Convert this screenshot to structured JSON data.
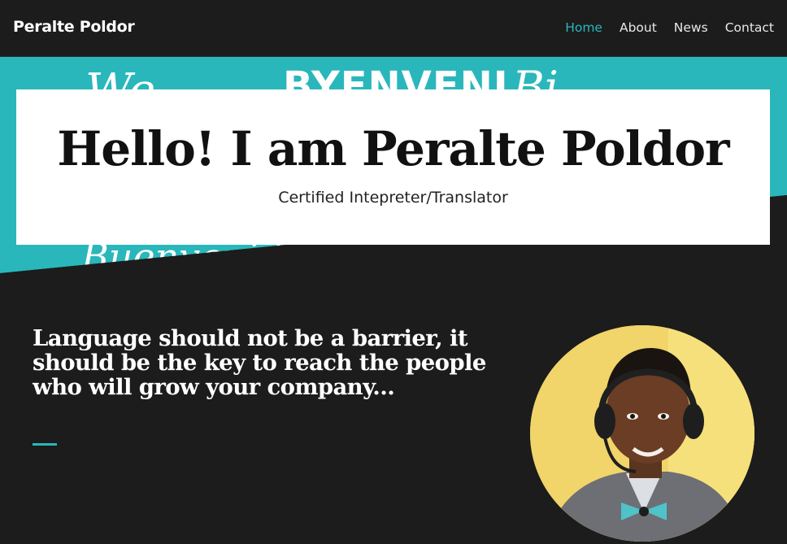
{
  "nav": {
    "brand": "Peralte Poldor",
    "items": [
      {
        "label": "Home",
        "active": true
      },
      {
        "label": "About",
        "active": false
      },
      {
        "label": "News",
        "active": false
      },
      {
        "label": "Contact",
        "active": false
      }
    ]
  },
  "hero": {
    "title": "Hello! I am Peralte Poldor",
    "subtitle": "Certified Intepreter/Translator",
    "background_text": [
      "BYENVENI",
      "Buenvenido"
    ]
  },
  "main": {
    "quote": "Language should not be a barrier, it should be the key to reach the people who will grow your company..."
  },
  "colors": {
    "accent": "#2ab7bb",
    "dark": "#1c1c1c",
    "white": "#ffffff"
  },
  "icons": {
    "portrait": "profile-photo"
  }
}
